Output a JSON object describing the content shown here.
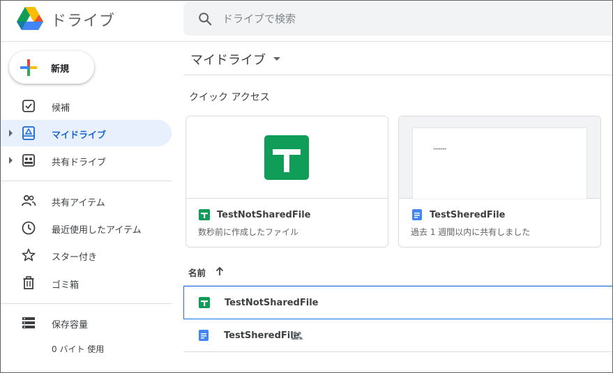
{
  "app": {
    "title": "ドライブ",
    "logo_icon": "google-drive-logo",
    "colors": {
      "accent": "#1967d2",
      "active_bg": "#e8f0fe",
      "sheets_green": "#0f9d58",
      "docs_blue": "#4285f4"
    }
  },
  "search": {
    "placeholder": "ドライブで検索",
    "value": "",
    "icon": "search-icon"
  },
  "sidebar": {
    "new_button": {
      "label": "新規",
      "icon": "plus-icon"
    },
    "items": [
      {
        "label": "候補",
        "icon": "check-box-icon",
        "active": false,
        "expandable": false
      },
      {
        "label": "マイドライブ",
        "icon": "my-drive-icon",
        "active": true,
        "expandable": true
      },
      {
        "label": "共有ドライブ",
        "icon": "shared-drive-icon",
        "active": false,
        "expandable": true
      },
      {
        "label": "共有アイテム",
        "icon": "people-icon",
        "active": false,
        "expandable": false
      },
      {
        "label": "最近使用したアイテム",
        "icon": "clock-icon",
        "active": false,
        "expandable": false
      },
      {
        "label": "スター付き",
        "icon": "star-icon",
        "active": false,
        "expandable": false
      },
      {
        "label": "ゴミ箱",
        "icon": "trash-icon",
        "active": false,
        "expandable": false
      },
      {
        "label": "保存容量",
        "icon": "storage-icon",
        "active": false,
        "expandable": false
      }
    ],
    "storage_usage": "0 バイト 使用"
  },
  "main": {
    "title": "マイドライブ",
    "quick_access": {
      "title": "クイック アクセス",
      "cards": [
        {
          "name": "TestNotSharedFile",
          "type": "sheets",
          "description": "数秒前に作成したファイル"
        },
        {
          "name": "TestSheredFile",
          "type": "docs",
          "description": "過去 1 週間以内に共有しました"
        }
      ]
    },
    "list": {
      "column_name": "名前",
      "sort": "ascending",
      "files": [
        {
          "name": "TestNotSharedFile",
          "type": "sheets",
          "shared": false,
          "selected": true
        },
        {
          "name": "TestSheredFile",
          "type": "docs",
          "shared": true,
          "selected": false
        }
      ]
    }
  }
}
